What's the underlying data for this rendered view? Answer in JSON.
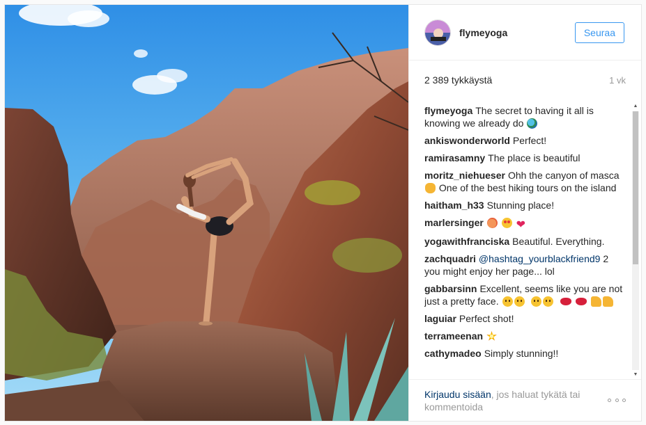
{
  "post": {
    "username": "flymeyoga",
    "follow_label": "Seuraa",
    "likes": "2 389 tykkäystä",
    "age": "1 vk"
  },
  "comments": [
    {
      "author": "flymeyoga",
      "text": "The secret to having it all is knowing we already do",
      "emoji": [
        "globe"
      ]
    },
    {
      "author": "ankiswonderworld",
      "text": "Perfect!"
    },
    {
      "author": "ramirasamny",
      "text": "The place is beautiful"
    },
    {
      "author": "moritz_niehueser",
      "text_before": "Ohh the canyon of masca",
      "text_after": " One of the best hiking tours on the island",
      "emoji_mid": "hand"
    },
    {
      "author": "haitham_h33",
      "text": "Stunning place!"
    },
    {
      "author": "marlersinger",
      "text": "",
      "emoji": [
        "peach",
        "heart-eyes",
        "heart"
      ]
    },
    {
      "author": "yogawithfranciska",
      "text": "Beautiful. Everything."
    },
    {
      "author": "zachquadri",
      "mention": "@hashtag_yourblackfriend9",
      "text": "2 you might enjoy her page... lol"
    },
    {
      "author": "gabbarsinn",
      "text": "Excellent, seems like you are not just a pretty face."
    },
    {
      "author": "laguiar",
      "text": "Perfect shot!"
    },
    {
      "author": "terrameenan",
      "text": "",
      "emoji": [
        "sparkle"
      ]
    },
    {
      "author": "cathymadeo",
      "text": "Simply stunning!!"
    }
  ],
  "footer": {
    "login_link": "Kirjaudu sisään",
    "login_text": ", jos haluat tykätä tai kommentoida"
  },
  "colors": {
    "accent": "#3897f0",
    "link": "#003569",
    "muted": "#999999"
  }
}
